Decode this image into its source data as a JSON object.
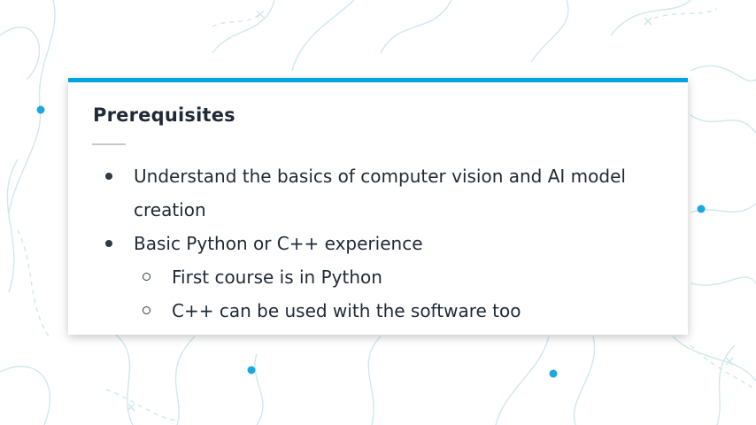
{
  "slide": {
    "title": "Prerequisites",
    "accent_color": "#02a3e0",
    "bullets": [
      {
        "text": "Understand the basics of computer vision and AI model creation",
        "sub_items": []
      },
      {
        "text": "Basic Python or C++ experience",
        "sub_items": [
          "First course is in Python",
          "C++ can be used with the software too"
        ]
      }
    ]
  },
  "icons": [
    "bullet-disc-icon",
    "bullet-circle-icon",
    "background-dot-icon",
    "background-x-icon"
  ]
}
